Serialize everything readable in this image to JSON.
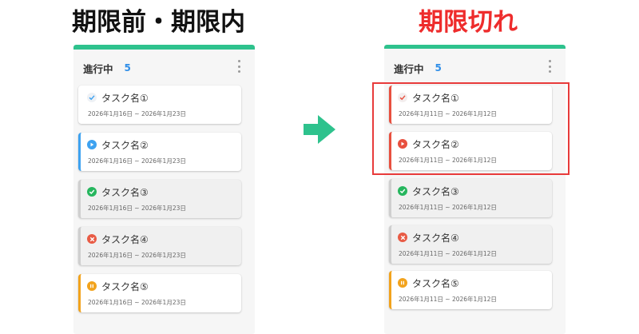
{
  "headings": {
    "before": "期限前・期限内",
    "after": "期限切れ"
  },
  "colors": {
    "column_top_bar": "#2ec28d",
    "count_blue": "#2f8ee8",
    "overdue_red": "#e8503f",
    "in_progress_blue": "#3ea2f0",
    "done_green": "#26b65e",
    "cancel_red": "#e85b45",
    "paused_orange": "#f2a31d",
    "highlight_red": "#e83b3b",
    "arrow_green": "#2ec28d"
  },
  "left_column": {
    "title": "進行中",
    "count": "5",
    "cards": [
      {
        "title": "タスク名①",
        "date": "2026年1月16日 ~ 2026年1月23日",
        "icon": "check-icon",
        "accent": "none"
      },
      {
        "title": "タスク名②",
        "date": "2026年1月16日 ~ 2026年1月23日",
        "icon": "play-icon",
        "accent": "#3ea2f0"
      },
      {
        "title": "タスク名③",
        "date": "2026年1月16日 ~ 2026年1月23日",
        "icon": "check-circle-icon",
        "accent": "#cfcfcf"
      },
      {
        "title": "タスク名④",
        "date": "2026年1月16日 ~ 2026年1月23日",
        "icon": "close-circle-icon",
        "accent": "#cfcfcf"
      },
      {
        "title": "タスク名⑤",
        "date": "2026年1月16日 ~ 2026年1月23日",
        "icon": "pause-icon",
        "accent": "#f2a31d"
      }
    ]
  },
  "right_column": {
    "title": "進行中",
    "count": "5",
    "cards": [
      {
        "title": "タスク名①",
        "date": "2026年1月11日 ~ 2026年1月12日",
        "icon": "check-icon",
        "accent": "#e8503f"
      },
      {
        "title": "タスク名②",
        "date": "2026年1月11日 ~ 2026年1月12日",
        "icon": "play-icon",
        "accent": "#e8503f"
      },
      {
        "title": "タスク名③",
        "date": "2026年1月11日 ~ 2026年1月12日",
        "icon": "check-circle-icon",
        "accent": "#cfcfcf"
      },
      {
        "title": "タスク名④",
        "date": "2026年1月11日 ~ 2026年1月12日",
        "icon": "close-circle-icon",
        "accent": "#cfcfcf"
      },
      {
        "title": "タスク名⑤",
        "date": "2026年1月11日 ~ 2026年1月12日",
        "icon": "pause-icon",
        "accent": "#f2a31d"
      }
    ]
  }
}
